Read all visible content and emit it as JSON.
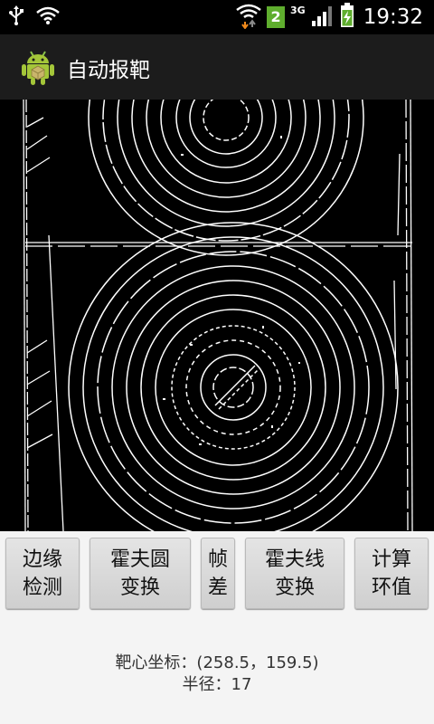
{
  "status_bar": {
    "time": "19:32",
    "badge_number": "2",
    "network_type": "3G",
    "icons": [
      "usb-icon",
      "wifi-icon",
      "wifi-transfer-icon",
      "sim-badge",
      "signal-icon",
      "battery-charging-icon"
    ]
  },
  "app": {
    "title": "自动报靶",
    "icon": "android-icon"
  },
  "buttons": [
    {
      "label": "边缘\n检测"
    },
    {
      "label": "霍夫圆\n变换"
    },
    {
      "label": "帧\n差"
    },
    {
      "label": "霍夫线\n变换"
    },
    {
      "label": "计算\n环值"
    }
  ],
  "result": {
    "center_text": "靶心坐标：(258.5，159.5)",
    "radius_text": "半径：17"
  },
  "colors": {
    "status_bar_bg": "#000000",
    "title_bar_bg": "#1c1c1c",
    "image_bg": "#000000",
    "edge_lines": "#ffffff",
    "accent_green": "#5fae2e",
    "page_bg": "#f4f4f4"
  }
}
